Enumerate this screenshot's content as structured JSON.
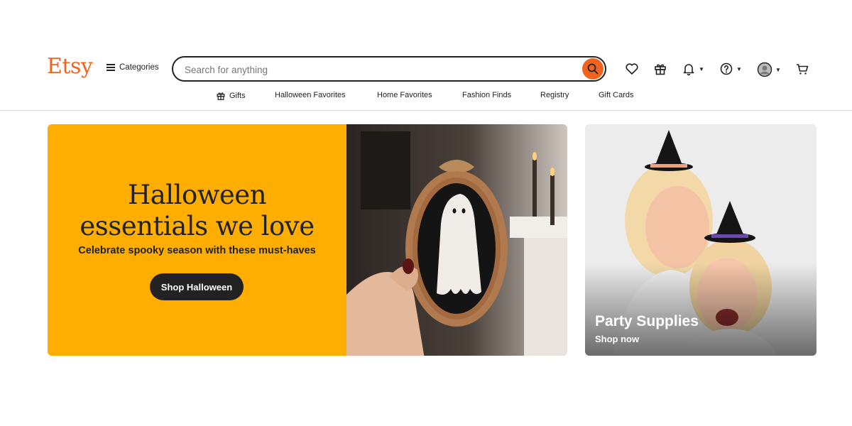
{
  "header": {
    "logo": "Etsy",
    "categories_label": "Categories",
    "search_placeholder": "Search for anything",
    "search_value": ""
  },
  "nav": {
    "items": [
      {
        "label": "Gifts",
        "icon": "gift-icon"
      },
      {
        "label": "Halloween Favorites"
      },
      {
        "label": "Home Favorites"
      },
      {
        "label": "Fashion Finds"
      },
      {
        "label": "Registry"
      },
      {
        "label": "Gift Cards"
      }
    ]
  },
  "icons": [
    "heart-icon",
    "gift-icon",
    "bell-icon",
    "help-icon",
    "account-icon",
    "cart-icon"
  ],
  "hero": {
    "title_line1": "Halloween",
    "title_line2": "essentials we love",
    "subtitle": "Celebrate spooky season with these must-haves",
    "button": "Shop Halloween",
    "background": "#fdae00"
  },
  "side_card": {
    "title": "Party Supplies",
    "link": "Shop now"
  },
  "colors": {
    "brand": "#f1641e",
    "hero_bg": "#fdae00",
    "button": "#222222"
  }
}
